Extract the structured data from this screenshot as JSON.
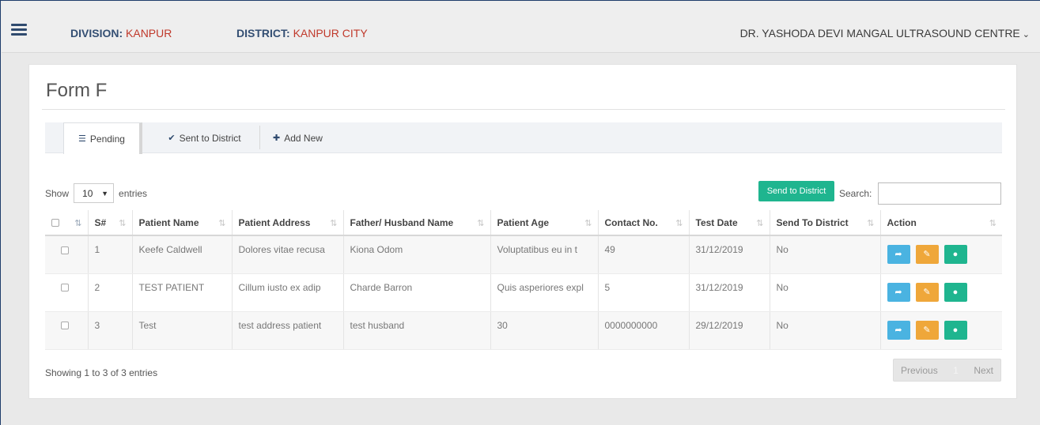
{
  "header": {
    "division_label": "DIVISION:",
    "division_value": "KANPUR",
    "district_label": "DISTRICT:",
    "district_value": "KANPUR CITY",
    "centre_name": "DR. YASHODA DEVI MANGAL ULTRASOUND CENTRE",
    "centre_chevron": "⌄"
  },
  "page": {
    "title": "Form F"
  },
  "tabs": [
    {
      "label": "Pending",
      "icon": "list-icon",
      "glyph": "☰",
      "active": true
    },
    {
      "label": "Sent to District",
      "icon": "check-icon",
      "glyph": "✔",
      "active": false
    },
    {
      "label": "Add New",
      "icon": "plus-icon",
      "glyph": "✚",
      "active": false
    }
  ],
  "length": {
    "show": "Show",
    "value": "10",
    "entries": "entries"
  },
  "send_button": "Send to District",
  "search": {
    "label": "Search:",
    "value": ""
  },
  "table": {
    "columns": [
      "S#",
      "Patient Name",
      "Patient Address",
      "Father/ Husband Name",
      "Patient Age",
      "Contact No.",
      "Test Date",
      "Send To District",
      "Action"
    ],
    "rows": [
      {
        "sno": "1",
        "name": "Keefe Caldwell",
        "address": "Dolores vitae recusa",
        "guardian": "Kiona Odom",
        "age": "Voluptatibus eu in t",
        "contact": "49",
        "date": "31/12/2019",
        "sent": "No"
      },
      {
        "sno": "2",
        "name": "TEST PATIENT",
        "address": "Cillum iusto ex adip",
        "guardian": "Charde Barron",
        "age": "Quis asperiores expl",
        "contact": "5",
        "date": "31/12/2019",
        "sent": "No"
      },
      {
        "sno": "3",
        "name": "Test",
        "address": "test address patient",
        "guardian": "test husband",
        "age": "30",
        "contact": "0000000000",
        "date": "29/12/2019",
        "sent": "No"
      }
    ]
  },
  "footer": {
    "info": "Showing 1 to 3 of 3 entries",
    "previous": "Previous",
    "page": "1",
    "next": "Next"
  },
  "colors": {
    "brand_navy": "#344f73",
    "value_red": "#c0392b",
    "success_green": "#1fb58f",
    "info_blue": "#4ab3e1",
    "warning_orange": "#efa73a"
  }
}
